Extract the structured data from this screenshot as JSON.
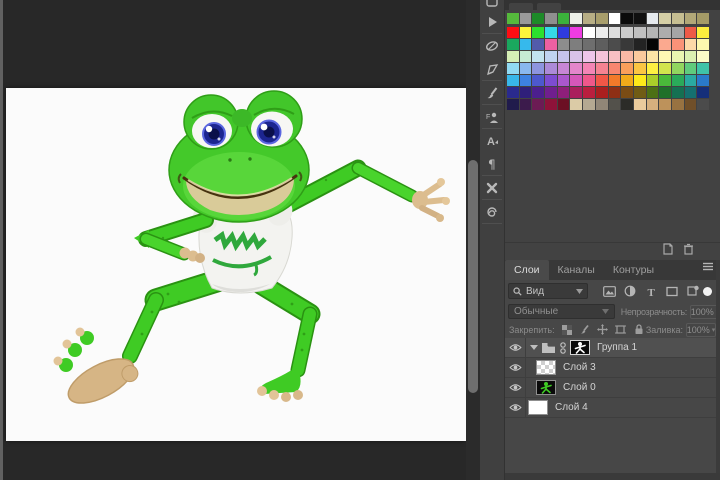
{
  "window": {
    "app": "image-editor-dark-ui"
  },
  "canvas": {
    "description": "dancing cartoon green frog wearing white t-shirt with green logo"
  },
  "dock": {
    "icons": [
      "collapsed-panel-partial",
      "actions-play",
      "properties-ellipse",
      "styles-pen",
      "brush-settings",
      "clone-source-person",
      "character-panel",
      "paragraph-panel",
      "cross-tools",
      "spiral-notes"
    ]
  },
  "swatches": {
    "recent_row": [
      "#55b93c",
      "#9a9a9a",
      "#1d8a28",
      "#8f8f8f",
      "#3bb23b",
      "#eef1e9",
      "#b7ae85",
      "#a89e6c",
      "#ffffff",
      "#0b0b0b",
      "#101010",
      "#e6eaee",
      "#d5cfa6",
      "#c7bf92",
      "#b2a878",
      "#a59b67"
    ],
    "rows": [
      [
        "#fd0d13",
        "#fdf43b",
        "#2ce12e",
        "#35d9e8",
        "#2f3be0",
        "#ee3ce2",
        "#ffffff",
        "#ececec",
        "#dcdcdc",
        "#cccccc",
        "#c0c0c0",
        "#b5b5b5",
        "#adadad",
        "#a5a5a5",
        "#ee5a47",
        "#fdee3e"
      ],
      [
        "#1aa85e",
        "#36b9ec",
        "#525bab",
        "#ee60a2",
        "#8d8d8d",
        "#7e7e7e",
        "#6e6e6e",
        "#5e5e5e",
        "#4c4c4c",
        "#393939",
        "#232323",
        "#050505",
        "#fba98f",
        "#fa9278",
        "#fdd9a8",
        "#fdf8af"
      ],
      [
        "#d5eeb5",
        "#c6ebd4",
        "#c2e4ef",
        "#c0d4f1",
        "#c6c3eb",
        "#d8c2e9",
        "#edc5ea",
        "#f5c3da",
        "#f7bfc3",
        "#f9b9a5",
        "#fbca9d",
        "#fde5a6",
        "#fef8b3",
        "#ebf5b1",
        "#dbf0b1",
        "#fdfdc8"
      ],
      [
        "#91daf3",
        "#89b8ef",
        "#8d95df",
        "#ac8ad8",
        "#c786d5",
        "#e486cb",
        "#f385b5",
        "#f58392",
        "#f78670",
        "#f99f5b",
        "#fbc643",
        "#fdf042",
        "#d2e54d",
        "#91d65f",
        "#5fcb7d",
        "#3fc3a8"
      ],
      [
        "#38b7e9",
        "#3d81e1",
        "#4d58cd",
        "#7d4cd1",
        "#aa57cd",
        "#d657b9",
        "#ef578a",
        "#f15747",
        "#f17a2a",
        "#f1aa1a",
        "#fdea1a",
        "#aace2a",
        "#4aba3a",
        "#2aaa5a",
        "#2aaaa2",
        "#2a7aca"
      ],
      [
        "#2a2a8e",
        "#2f1f7a",
        "#4c1f8e",
        "#701f8e",
        "#8e1f7a",
        "#aa1f5c",
        "#ba1f3e",
        "#aa1f1f",
        "#8e2f15",
        "#7a4c15",
        "#705c15",
        "#4c7015",
        "#1f7029",
        "#157052",
        "#157070",
        "#152f7a"
      ],
      [
        "#201b4c",
        "#3c1b4c",
        "#6c1b54",
        "#8e1239",
        "#6c1024",
        "#dbcba6",
        "#b5a992",
        "#918677",
        "#53514b",
        "#2c2c28",
        "#eacb9c",
        "#d6b07e",
        "#bd925b",
        "#987241",
        "#704f29",
        "#4b4b4b"
      ]
    ],
    "icons": [
      "new-swatch",
      "delete-swatch"
    ]
  },
  "layers_panel": {
    "tabs": [
      {
        "label": "Слои",
        "active": true
      },
      {
        "label": "Каналы",
        "active": false
      },
      {
        "label": "Контуры",
        "active": false
      }
    ],
    "filter_kind": "Вид",
    "blend_mode": "Обычные",
    "opacity_label": "Непрозрачность:",
    "opacity_value": "100%",
    "lock_label": "Закрепить:",
    "fill_label": "Заливка:",
    "fill_value": "100%",
    "layers": [
      {
        "name": "Группа 1",
        "type": "group",
        "expanded": true,
        "visible": true
      },
      {
        "name": "Слой 3",
        "type": "layer",
        "thumb": "transparent",
        "visible": true
      },
      {
        "name": "Слой 0",
        "type": "layer",
        "thumb": "frog",
        "visible": true
      },
      {
        "name": "Слой 4",
        "type": "layer",
        "thumb": "white",
        "visible": true
      }
    ]
  }
}
